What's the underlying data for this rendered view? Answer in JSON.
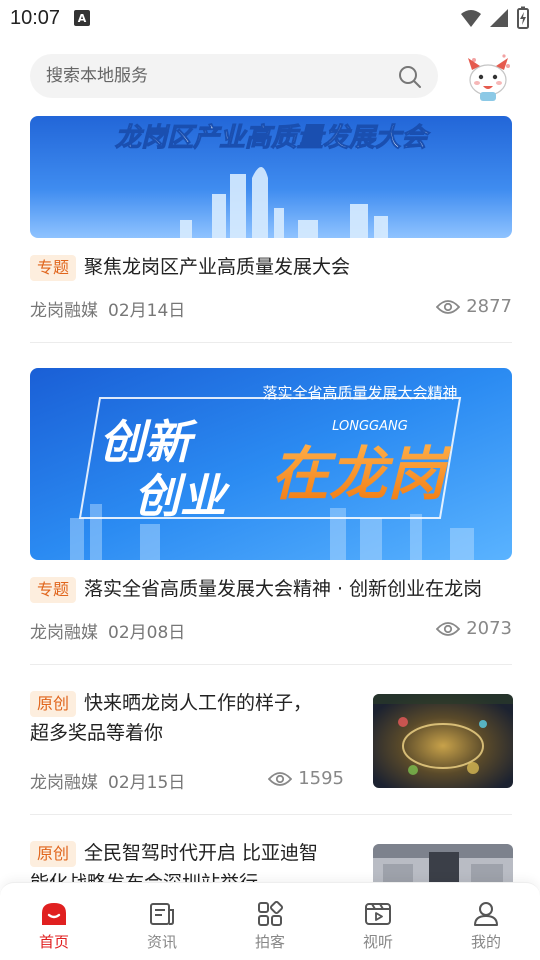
{
  "status_bar": {
    "time": "10:07",
    "notification_letter": "A"
  },
  "search": {
    "placeholder": "搜索本地服务"
  },
  "feed": [
    {
      "banner_text": "龙岗区产业高质量发展大会",
      "tag": "专题",
      "title": "聚焦龙岗区产业高质量发展大会",
      "source": "龙岗融媒",
      "date": "02月14日",
      "views": "2877"
    },
    {
      "banner_top_text": "落实全省高质量发展大会精神",
      "banner_main_left_1": "创新",
      "banner_main_left_2": "创业",
      "banner_main_right": "在龙岗",
      "banner_sub": "LONGGANG",
      "tag": "专题",
      "title": "落实全省高质量发展大会精神 · 创新创业在龙岗",
      "source": "龙岗融媒",
      "date": "02月08日",
      "views": "2073"
    },
    {
      "tag": "原创",
      "title_line1": "快来晒龙岗人工作的样子，",
      "title_line2": "超多奖品等着你",
      "source": "龙岗融媒",
      "date": "02月15日",
      "views": "1595"
    },
    {
      "tag": "原创",
      "title_line1": "全民智驾时代开启 比亚迪智",
      "title_line2": "能化战略发布会深圳站举行"
    }
  ],
  "tabs": [
    {
      "label": "首页",
      "icon": "home-icon",
      "active": true
    },
    {
      "label": "资讯",
      "icon": "news-icon",
      "active": false
    },
    {
      "label": "拍客",
      "icon": "grid-icon",
      "active": false
    },
    {
      "label": "视听",
      "icon": "video-icon",
      "active": false
    },
    {
      "label": "我的",
      "icon": "user-icon",
      "active": false
    }
  ],
  "colors": {
    "accent": "#e02020",
    "tag_text": "#e0651c",
    "tag_bg": "#fdeede",
    "banner_blue": "#1f6fe0"
  }
}
